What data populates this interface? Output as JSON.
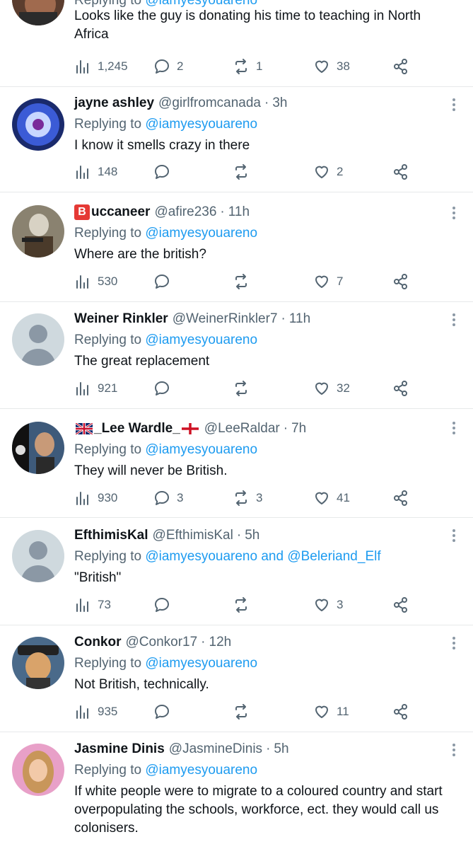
{
  "top_tweet": {
    "reply_to": "@iamyesyouareno",
    "reply_prefix": "Replying to",
    "text": "Looks like the guy is donating his time to teaching in North Africa",
    "views": "1,245",
    "replies": "2",
    "retweets": "1",
    "likes": "38"
  },
  "tweets": [
    {
      "name": "jayne ashley",
      "handle": "@girlfromcanada",
      "time": "3h",
      "reply_prefix": "Replying to",
      "reply_to": "@iamyesyouareno",
      "text": "I know it smells crazy in there",
      "views": "148",
      "replies": "",
      "retweets": "",
      "likes": "2"
    },
    {
      "name_badge": "B",
      "name": "uccaneer",
      "handle": "@afire236",
      "time": "11h",
      "reply_prefix": "Replying to",
      "reply_to": "@iamyesyouareno",
      "text": "Where are the british?",
      "views": "530",
      "replies": "",
      "retweets": "",
      "likes": "7"
    },
    {
      "name": "Weiner Rinkler",
      "handle": "@WeinerRinkler7",
      "time": "11h",
      "reply_prefix": "Replying to",
      "reply_to": "@iamyesyouareno",
      "text": "The great replacement",
      "views": "921",
      "replies": "",
      "retweets": "",
      "likes": "32"
    },
    {
      "name": "_Lee Wardle_",
      "handle": "@LeeRaldar",
      "time": "7h",
      "reply_prefix": "Replying to",
      "reply_to": "@iamyesyouareno",
      "text": "They will never be British.",
      "views": "930",
      "replies": "3",
      "retweets": "3",
      "likes": "41"
    },
    {
      "name": "EfthimisKal",
      "handle": "@EfthimisKal",
      "time": "5h",
      "reply_prefix": "Replying to",
      "reply_to": "@iamyesyouareno",
      "reply_and": "and",
      "reply_to_2": "@Beleriand_Elf",
      "text": "\"British\"",
      "views": "73",
      "replies": "",
      "retweets": "",
      "likes": "3"
    },
    {
      "name": "Conkor",
      "handle": "@Conkor17",
      "time": "12h",
      "reply_prefix": "Replying to",
      "reply_to": "@iamyesyouareno",
      "text": "Not British, technically.",
      "views": "935",
      "replies": "",
      "retweets": "",
      "likes": "11"
    },
    {
      "name": "Jasmine Dinis",
      "handle": "@JasmineDinis",
      "time": "5h",
      "reply_prefix": "Replying to",
      "reply_to": "@iamyesyouareno",
      "text": "If white people were to migrate to a coloured country and start overpopulating the schools, workforce, ect. they would call us colonisers.",
      "views": "",
      "replies": "",
      "retweets": "",
      "likes": ""
    }
  ],
  "dot_separator": "·",
  "colors": {
    "link": "#1d9bf0",
    "secondary": "#536471",
    "divider": "#e7e9ea",
    "badge": "#e53935"
  }
}
